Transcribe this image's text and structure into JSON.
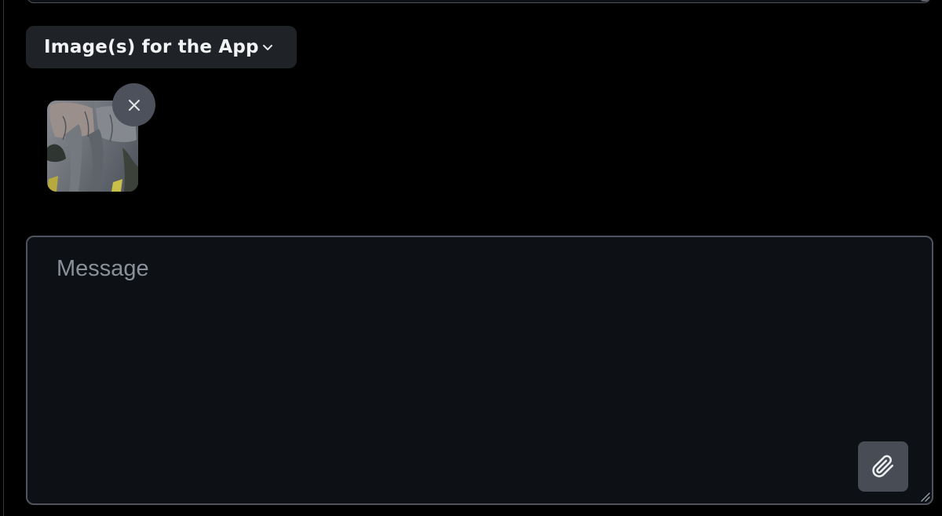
{
  "image_section": {
    "dropdown_label": "Image(s) for the App",
    "dropdown_icon": "chevron-down-icon",
    "thumbnail_subject": "elephant",
    "remove_icon": "close-icon"
  },
  "composer": {
    "placeholder": "Message",
    "value": "",
    "attach_icon": "paperclip-icon",
    "resize_icon": "resize-handle-icon"
  },
  "colors": {
    "background": "#000000",
    "dropdown_bg": "#1f2226",
    "input_bg": "#0d1015",
    "input_border": "#4e545d",
    "button_bg": "#474c55",
    "remove_bg": "#4c515b"
  }
}
